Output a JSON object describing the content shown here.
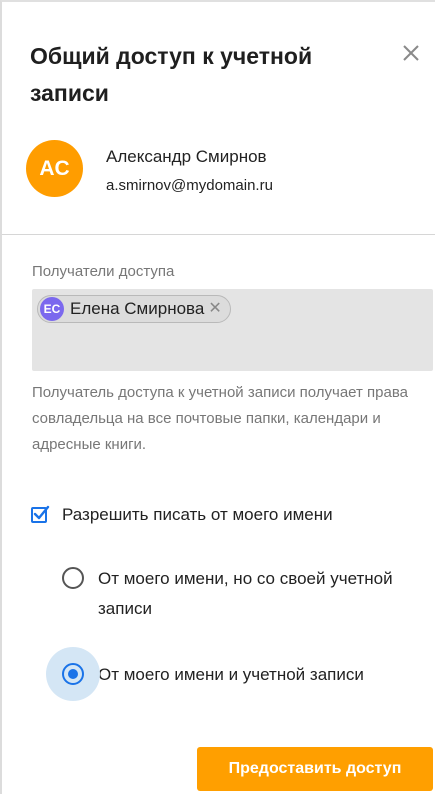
{
  "dialog": {
    "title": "Общий доступ к учетной записи"
  },
  "owner": {
    "initials": "AC",
    "avatar_color": "#ff9d00",
    "name": "Александр Смирнов",
    "email": "a.smirnov@mydomain.ru"
  },
  "recipients": {
    "label": "Получатели доступа",
    "chips": [
      {
        "initials": "EC",
        "name": "Елена Смирнова",
        "avatar_color": "#7b68ee"
      }
    ]
  },
  "hint": "Получатель доступа к учетной записи получает права совладельца на все почтовые папки, календари и адресные книги.",
  "send_as": {
    "checkbox_label": "Разрешить писать от моего имени",
    "checked": true,
    "options": [
      {
        "label": "От моего имени, но со своей учетной записи",
        "selected": false
      },
      {
        "label": "От моего имени и учетной записи",
        "selected": true
      }
    ]
  },
  "submit_label": "Предоставить доступ",
  "colors": {
    "accent": "#ff9f00",
    "selected": "#1a73e8"
  }
}
